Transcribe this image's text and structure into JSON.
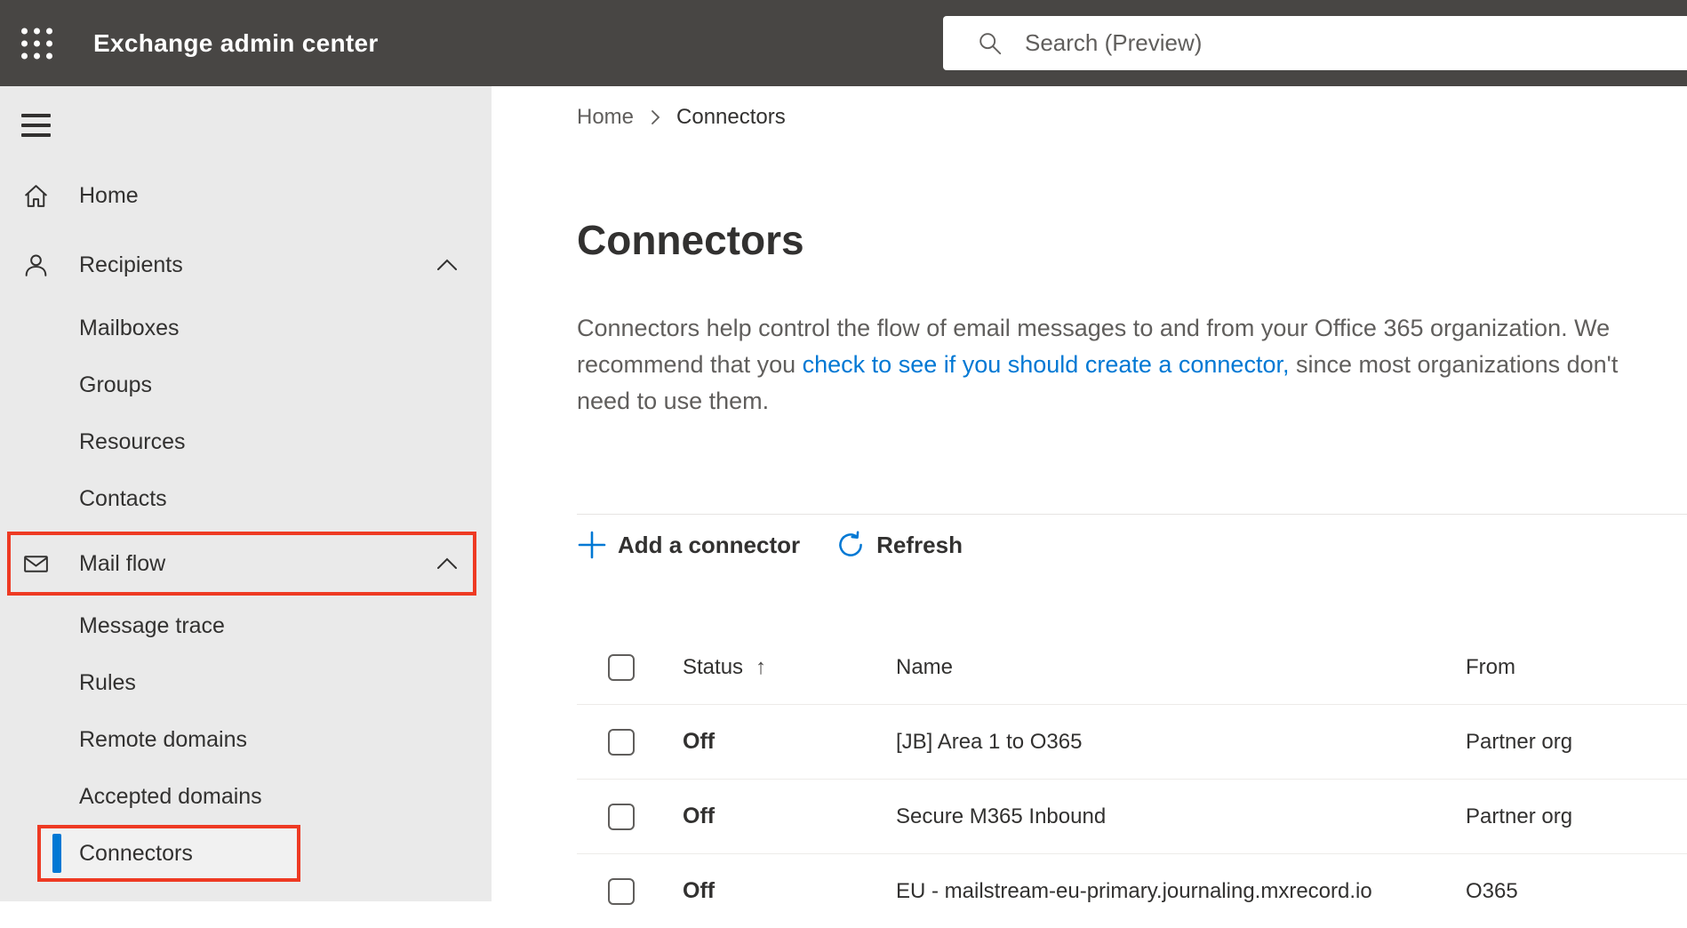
{
  "colors": {
    "accent": "#0078d4",
    "annotation_red": "#ee3a23",
    "header_bg": "#484644"
  },
  "header": {
    "app_title": "Exchange admin center",
    "search_placeholder": "Search (Preview)"
  },
  "sidebar": {
    "items": {
      "home": "Home",
      "recipients": "Recipients",
      "mailboxes": "Mailboxes",
      "groups": "Groups",
      "resources": "Resources",
      "contacts": "Contacts",
      "mail_flow": "Mail flow",
      "message_trace": "Message trace",
      "rules": "Rules",
      "remote_domains": "Remote domains",
      "accepted_domains": "Accepted domains",
      "connectors": "Connectors"
    },
    "selected": "Connectors"
  },
  "breadcrumb": {
    "home": "Home",
    "current": "Connectors"
  },
  "page": {
    "title": "Connectors",
    "description": {
      "before": "Connectors help control the flow of email messages to and from your Office 365 organization. We recommend that you ",
      "link": "check to see if you should create a connector,",
      "after": " since most organizations don't need to use them."
    }
  },
  "toolbar": {
    "add": "Add a connector",
    "refresh": "Refresh"
  },
  "table": {
    "columns": {
      "status": "Status",
      "name": "Name",
      "from": "From"
    },
    "sort": {
      "column": "Status",
      "direction": "asc",
      "glyph": "↑"
    },
    "rows": [
      {
        "status": "Off",
        "name": "[JB] Area 1 to O365",
        "from": "Partner org"
      },
      {
        "status": "Off",
        "name": "Secure M365 Inbound",
        "from": "Partner org"
      },
      {
        "status": "Off",
        "name": "EU - mailstream-eu-primary.journaling.mxrecord.io",
        "from": "O365"
      }
    ]
  }
}
